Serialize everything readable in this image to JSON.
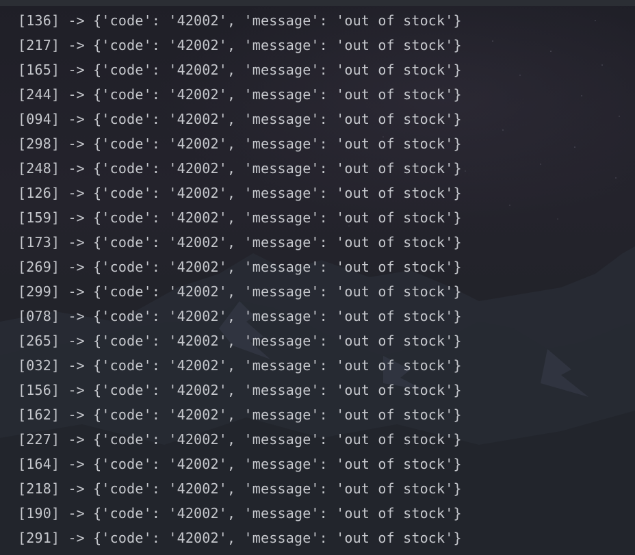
{
  "console": {
    "lines": [
      "[136] -> {'code': '42002', 'message': 'out of stock'}",
      "[217] -> {'code': '42002', 'message': 'out of stock'}",
      "[165] -> {'code': '42002', 'message': 'out of stock'}",
      "[244] -> {'code': '42002', 'message': 'out of stock'}",
      "[094] -> {'code': '42002', 'message': 'out of stock'}",
      "[298] -> {'code': '42002', 'message': 'out of stock'}",
      "[248] -> {'code': '42002', 'message': 'out of stock'}",
      "[126] -> {'code': '42002', 'message': 'out of stock'}",
      "[159] -> {'code': '42002', 'message': 'out of stock'}",
      "[173] -> {'code': '42002', 'message': 'out of stock'}",
      "[269] -> {'code': '42002', 'message': 'out of stock'}",
      "[299] -> {'code': '42002', 'message': 'out of stock'}",
      "[078] -> {'code': '42002', 'message': 'out of stock'}",
      "[265] -> {'code': '42002', 'message': 'out of stock'}",
      "[032] -> {'code': '42002', 'message': 'out of stock'}",
      "[156] -> {'code': '42002', 'message': 'out of stock'}",
      "[162] -> {'code': '42002', 'message': 'out of stock'}",
      "[227] -> {'code': '42002', 'message': 'out of stock'}",
      "[164] -> {'code': '42002', 'message': 'out of stock'}",
      "[218] -> {'code': '42002', 'message': 'out of stock'}",
      "[190] -> {'code': '42002', 'message': 'out of stock'}",
      "[291] -> {'code': '42002', 'message': 'out of stock'}"
    ]
  },
  "colors": {
    "text": "#c6c8cd",
    "background": "#1e2024",
    "top_strip": "#2b2e34"
  }
}
